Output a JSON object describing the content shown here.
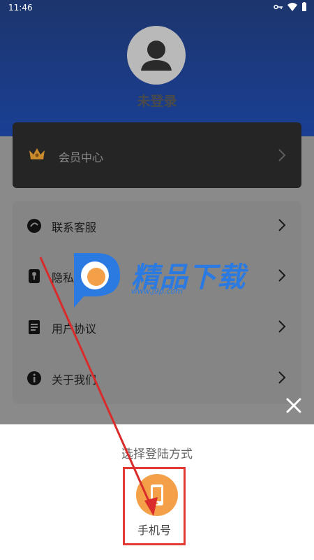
{
  "status_bar": {
    "time": "11:46"
  },
  "profile": {
    "name": "未登录"
  },
  "vip": {
    "label": "会员中心"
  },
  "menu": {
    "items": [
      {
        "label": "联系客服",
        "icon": "customer-service-icon"
      },
      {
        "label": "隐私政策",
        "icon": "privacy-icon"
      },
      {
        "label": "用户协议",
        "icon": "agreement-icon"
      },
      {
        "label": "关于我们",
        "icon": "info-icon"
      }
    ]
  },
  "login_sheet": {
    "title": "选择登陆方式",
    "options": [
      {
        "label": "手机号",
        "icon": "phone-icon"
      }
    ]
  },
  "watermark": {
    "text": "精品下载",
    "url": "www.j9p.com"
  },
  "colors": {
    "header": "#1a3f94",
    "accent_orange": "#f4a048",
    "annotation_red": "#e23a34"
  }
}
